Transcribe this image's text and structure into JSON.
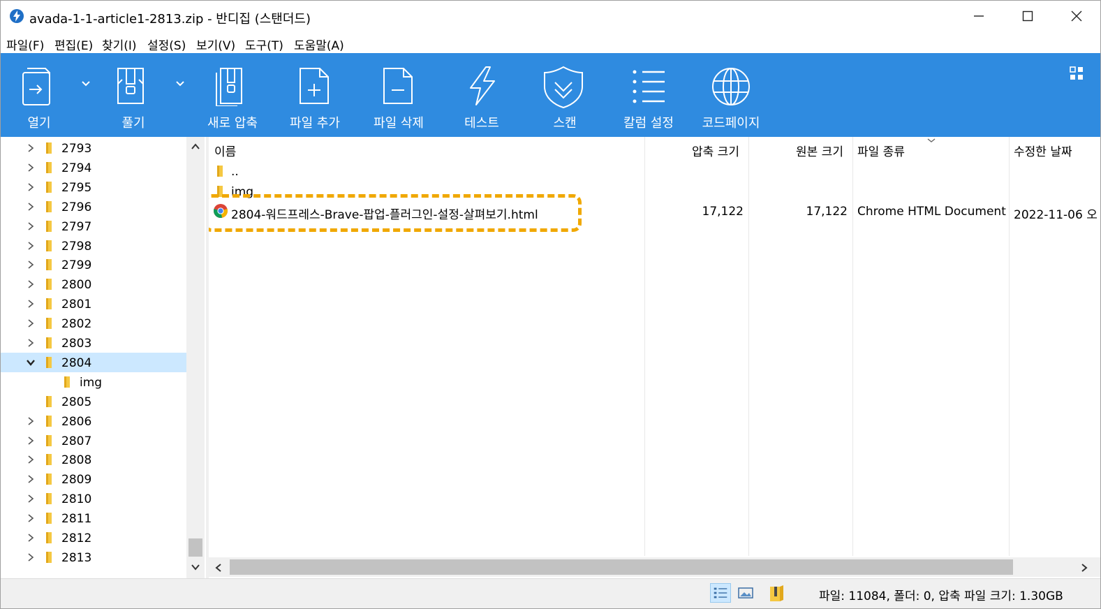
{
  "window": {
    "title": "avada-1-1-article1-2813.zip - 반디집 (스탠더드)"
  },
  "menu": [
    {
      "label": "파일(F)"
    },
    {
      "label": "편집(E)"
    },
    {
      "label": "찾기(I)"
    },
    {
      "label": "설정(S)"
    },
    {
      "label": "보기(V)"
    },
    {
      "label": "도구(T)"
    },
    {
      "label": "도움말(A)"
    }
  ],
  "toolbar": {
    "background": "#2f8be0",
    "buttons": [
      {
        "label": "열기",
        "icon": "open-icon"
      },
      {
        "label": "풀기",
        "icon": "extract-icon"
      },
      {
        "label": "새로 압축",
        "icon": "new-archive-icon"
      },
      {
        "label": "파일 추가",
        "icon": "add-file-icon"
      },
      {
        "label": "파일 삭제",
        "icon": "delete-file-icon"
      },
      {
        "label": "테스트",
        "icon": "test-icon"
      },
      {
        "label": "스캔",
        "icon": "scan-icon"
      },
      {
        "label": "칼럼 설정",
        "icon": "column-settings-icon"
      },
      {
        "label": "코드페이지",
        "icon": "codepage-icon"
      }
    ]
  },
  "tree": {
    "items": [
      {
        "label": "2793",
        "expanded": false,
        "selected": false,
        "level": 0
      },
      {
        "label": "2794",
        "expanded": false,
        "selected": false,
        "level": 0
      },
      {
        "label": "2795",
        "expanded": false,
        "selected": false,
        "level": 0
      },
      {
        "label": "2796",
        "expanded": false,
        "selected": false,
        "level": 0
      },
      {
        "label": "2797",
        "expanded": false,
        "selected": false,
        "level": 0
      },
      {
        "label": "2798",
        "expanded": false,
        "selected": false,
        "level": 0
      },
      {
        "label": "2799",
        "expanded": false,
        "selected": false,
        "level": 0
      },
      {
        "label": "2800",
        "expanded": false,
        "selected": false,
        "level": 0
      },
      {
        "label": "2801",
        "expanded": false,
        "selected": false,
        "level": 0
      },
      {
        "label": "2802",
        "expanded": false,
        "selected": false,
        "level": 0
      },
      {
        "label": "2803",
        "expanded": false,
        "selected": false,
        "level": 0
      },
      {
        "label": "2804",
        "expanded": true,
        "selected": true,
        "level": 0
      },
      {
        "label": "img",
        "expanded": false,
        "selected": false,
        "level": 1
      },
      {
        "label": "2805",
        "expanded": false,
        "selected": false,
        "level": 0
      },
      {
        "label": "2806",
        "expanded": false,
        "selected": false,
        "level": 0
      },
      {
        "label": "2807",
        "expanded": false,
        "selected": false,
        "level": 0
      },
      {
        "label": "2808",
        "expanded": false,
        "selected": false,
        "level": 0
      },
      {
        "label": "2809",
        "expanded": false,
        "selected": false,
        "level": 0
      },
      {
        "label": "2810",
        "expanded": false,
        "selected": false,
        "level": 0
      },
      {
        "label": "2811",
        "expanded": false,
        "selected": false,
        "level": 0
      },
      {
        "label": "2812",
        "expanded": false,
        "selected": false,
        "level": 0
      },
      {
        "label": "2813",
        "expanded": false,
        "selected": false,
        "level": 0
      }
    ]
  },
  "list": {
    "columns": {
      "name": "이름",
      "compressed": "압축 크기",
      "original": "원본 크기",
      "type": "파일 종류",
      "modified": "수정한 날짜"
    },
    "rows": [
      {
        "name": "..",
        "icon": "folder-icon",
        "compressed": "",
        "original": "",
        "type": "",
        "modified": ""
      },
      {
        "name": "img",
        "icon": "folder-icon",
        "compressed": "",
        "original": "",
        "type": "",
        "modified": ""
      },
      {
        "name": "2804-워드프레스-Brave-팝업-플러그인-설정-살펴보기.html",
        "icon": "chrome-icon",
        "compressed": "17,122",
        "original": "17,122",
        "type": "Chrome HTML Document",
        "modified": "2022-11-06 오"
      }
    ],
    "highlight_color": "#f0a800"
  },
  "status": {
    "text": "파일: 11084, 폴더: 0, 압축 파일 크기: 1.30GB"
  }
}
